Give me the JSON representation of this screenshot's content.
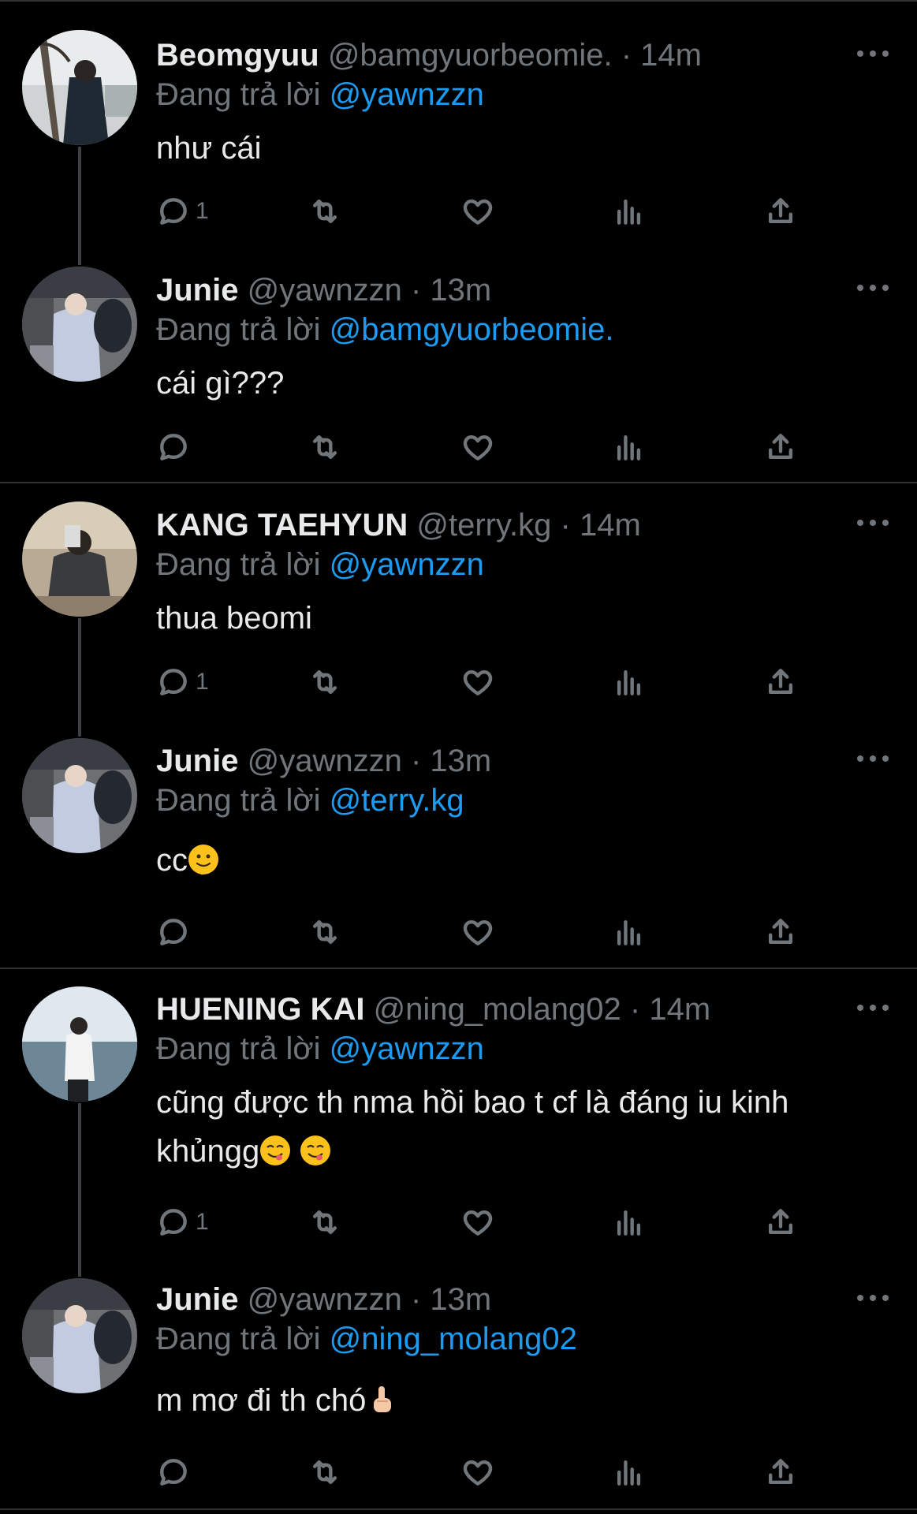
{
  "tweets": [
    {
      "name": "Beomgyuu",
      "handle": "@bamgyuorbeomie.",
      "time": "14m",
      "reply_prefix": "Đang trả lời",
      "reply_to": "@yawnzzn",
      "text": "như cái",
      "reply_count": "1"
    },
    {
      "name": "Junie",
      "handle": "@yawnzzn",
      "time": "13m",
      "reply_prefix": "Đang trả lời",
      "reply_to": "@bamgyuorbeomie.",
      "text": "cái gì???",
      "reply_count": ""
    },
    {
      "name": "KANG TAEHYUN",
      "handle": "@terry.kg",
      "time": "14m",
      "reply_prefix": "Đang trả lời",
      "reply_to": "@yawnzzn",
      "text": "thua beomi",
      "reply_count": "1"
    },
    {
      "name": "Junie",
      "handle": "@yawnzzn",
      "time": "13m",
      "reply_prefix": "Đang trả lời",
      "reply_to": "@terry.kg",
      "text": "cc",
      "reply_count": ""
    },
    {
      "name": "HUENING KAI",
      "handle": "@ning_molang02",
      "time": "14m",
      "reply_prefix": "Đang trả lời",
      "reply_to": "@yawnzzn",
      "text_line1": "cũng được th nma hồi bao t cf là đáng iu kinh",
      "text_line2": "khủngg",
      "reply_count": "1"
    },
    {
      "name": "Junie",
      "handle": "@yawnzzn",
      "time": "13m",
      "reply_prefix": "Đang trả lời",
      "reply_to": "@ning_molang02",
      "text": "m mơ đi th chó",
      "reply_count": ""
    }
  ],
  "separator": "·",
  "icons": {
    "reply": "reply-icon",
    "retweet": "retweet-icon",
    "like": "heart-icon",
    "views": "views-icon",
    "share": "share-icon",
    "more": "more-options-icon",
    "emoji_slight_smile": "slightly-smiling-face-icon",
    "emoji_yum": "face-savoring-food-icon",
    "emoji_point_up": "point-up-icon"
  },
  "colors": {
    "background": "#000000",
    "text": "#e7e9ea",
    "muted": "#71767b",
    "link": "#1d9bf0",
    "divider": "#2f3336"
  }
}
